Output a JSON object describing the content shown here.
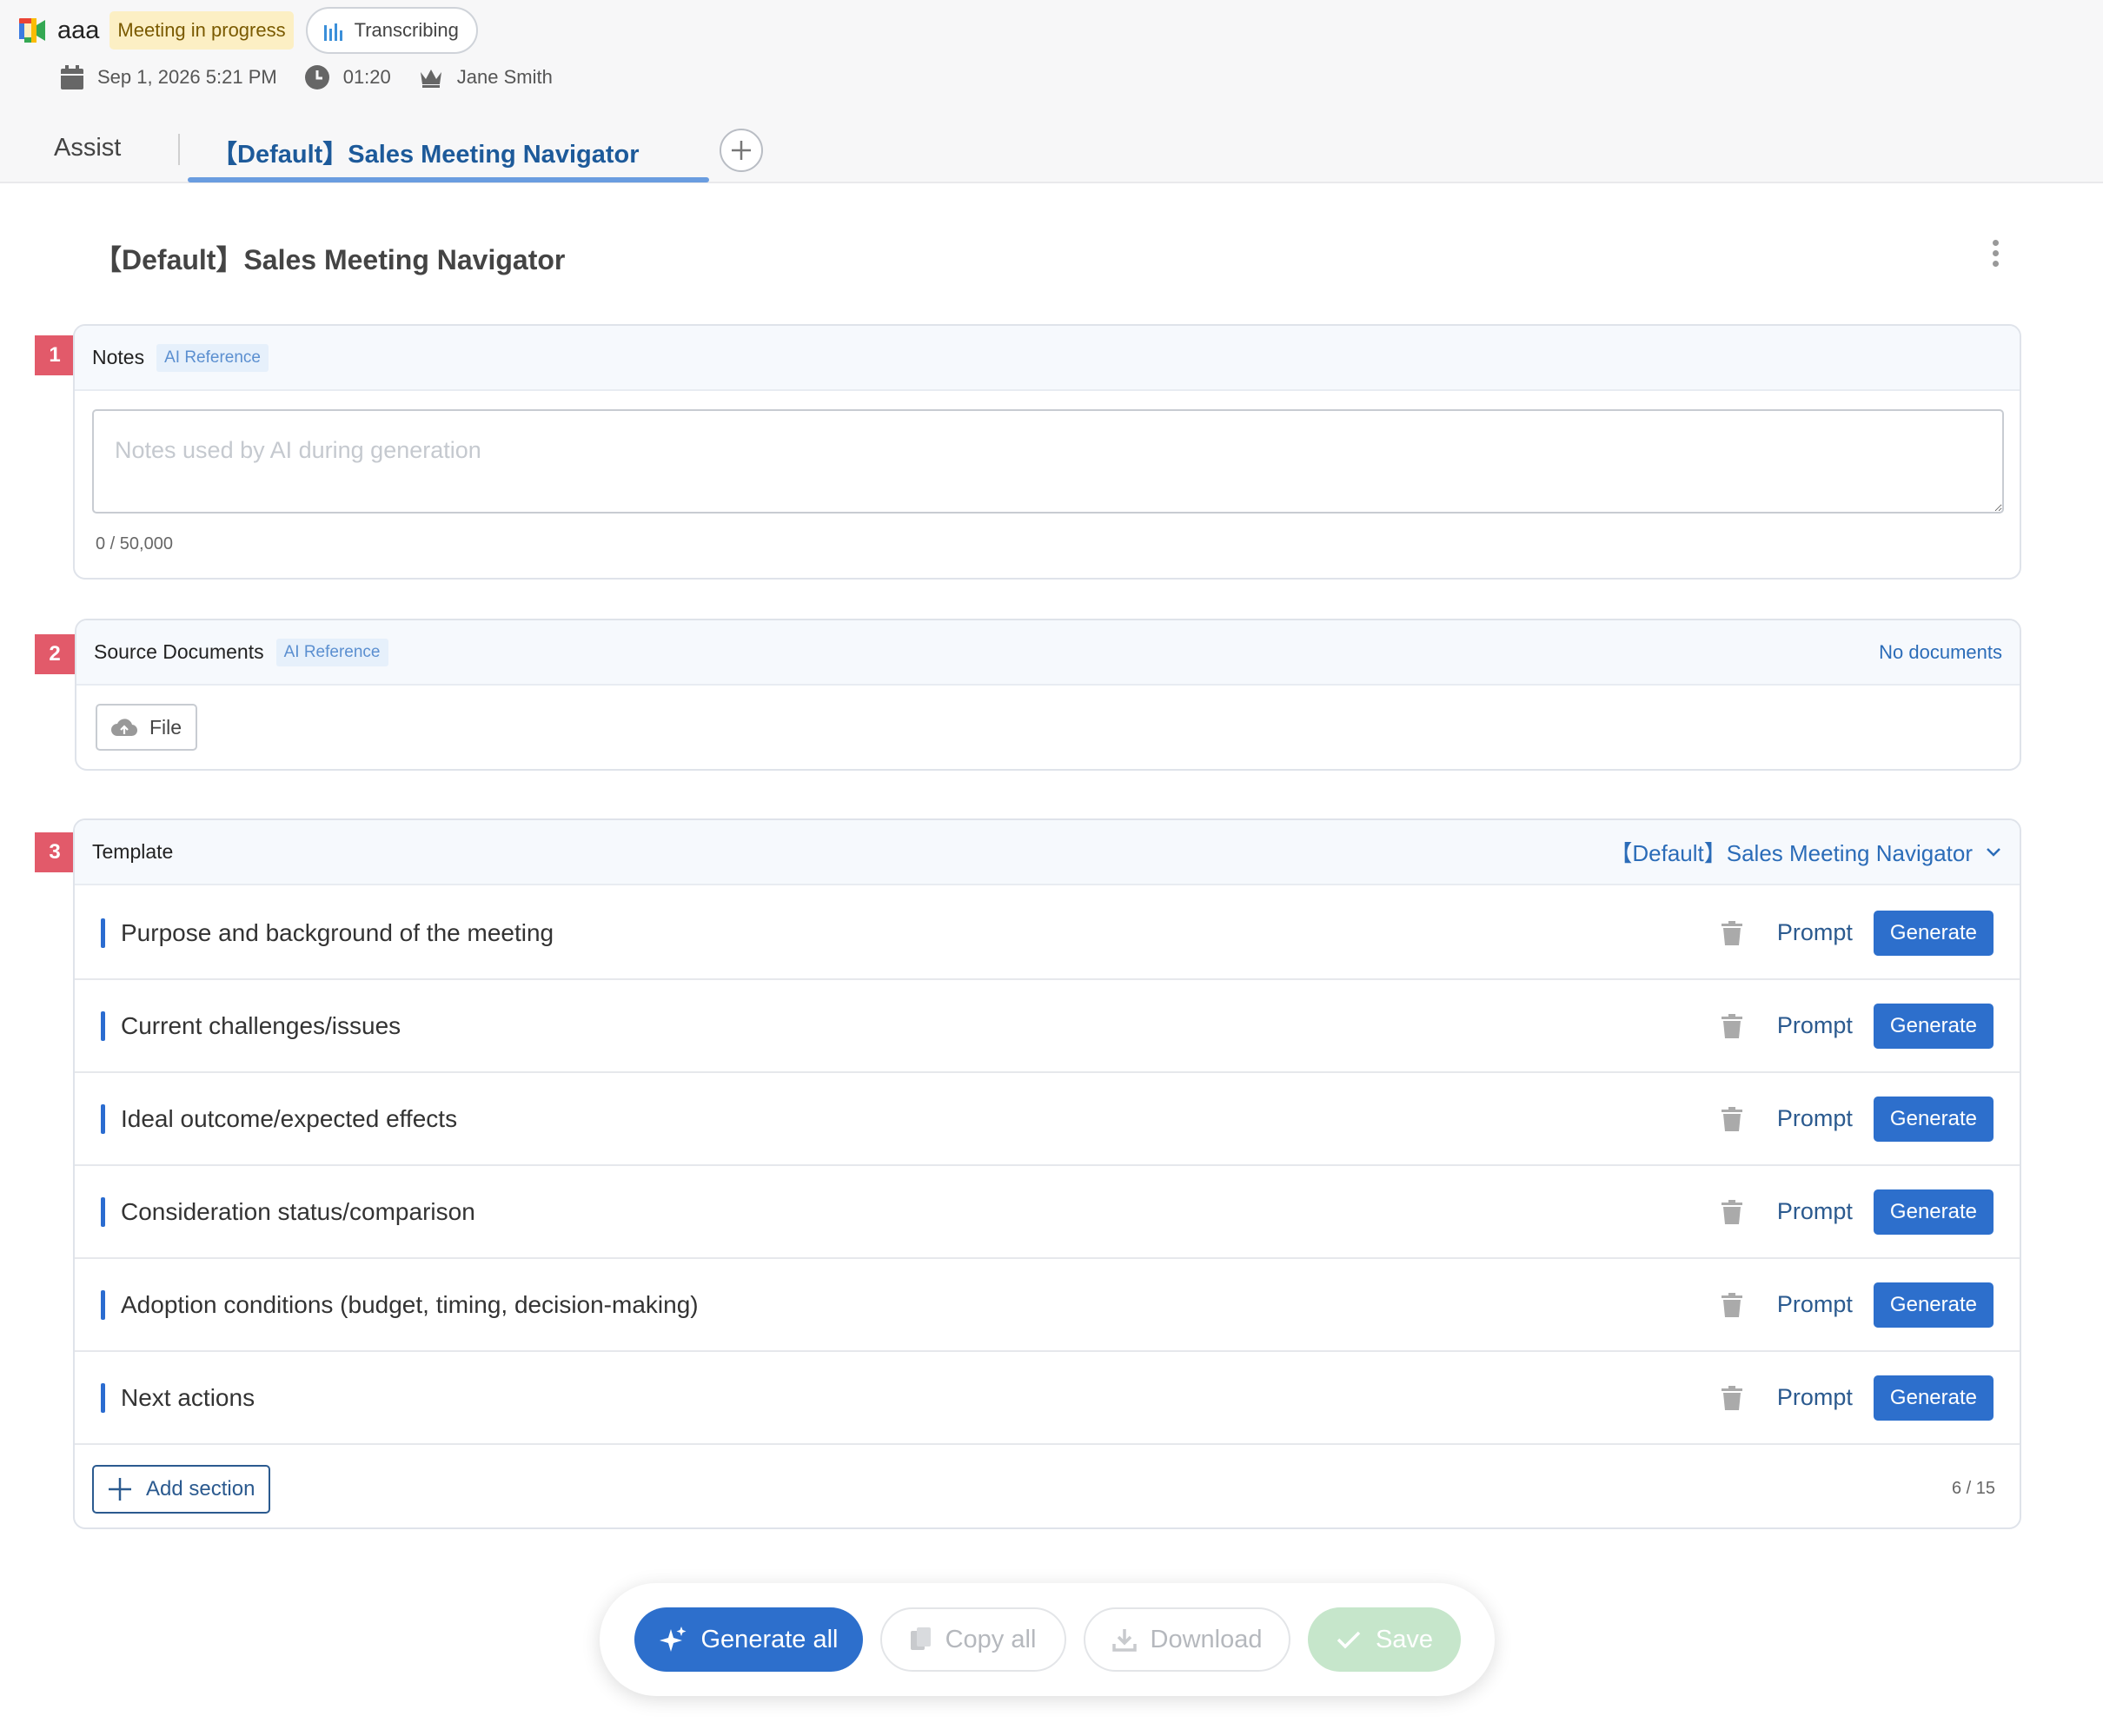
{
  "header": {
    "title": "aaa",
    "status_badge": "Meeting in progress",
    "transcribing_label": "Transcribing",
    "date": "Sep 1, 2026 5:21 PM",
    "duration": "01:20",
    "host": "Jane Smith"
  },
  "tabs": {
    "assist": "Assist",
    "active": "【Default】Sales Meeting Navigator"
  },
  "page_title": "【Default】Sales Meeting Navigator",
  "notes": {
    "number": "1",
    "label": "Notes",
    "badge": "AI Reference",
    "placeholder": "Notes used by AI during generation",
    "value": "",
    "counter": "0 / 50,000"
  },
  "source_documents": {
    "number": "2",
    "label": "Source Documents",
    "badge": "AI Reference",
    "status": "No documents",
    "file_button": "File"
  },
  "template": {
    "number": "3",
    "label": "Template",
    "selected": "【Default】Sales Meeting Navigator",
    "prompt_label": "Prompt",
    "generate_label": "Generate",
    "sections": [
      {
        "title": "Purpose and background of the meeting"
      },
      {
        "title": "Current challenges/issues"
      },
      {
        "title": "Ideal outcome/expected effects"
      },
      {
        "title": "Consideration status/comparison"
      },
      {
        "title": "Adoption conditions (budget, timing, decision-making)"
      },
      {
        "title": "Next actions"
      }
    ],
    "add_section": "Add section",
    "count": "6 / 15"
  },
  "actions": {
    "generate_all": "Generate all",
    "copy_all": "Copy all",
    "download": "Download",
    "save": "Save"
  },
  "colors": {
    "accent": "#2d6fcc",
    "section_number": "#e25a6a",
    "status_badge_bg": "#fcefc4",
    "save_disabled": "#c6e6cb"
  },
  "icons": {
    "app": "google-meet-icon",
    "transcribing": "audio-bars-icon",
    "date": "calendar-icon",
    "duration": "clock-icon",
    "host": "crown-icon",
    "file": "cloud-upload-icon",
    "delete": "trash-icon",
    "generate_all": "sparkle-icon",
    "copy": "copy-icon",
    "download": "download-icon",
    "save": "check-icon"
  }
}
